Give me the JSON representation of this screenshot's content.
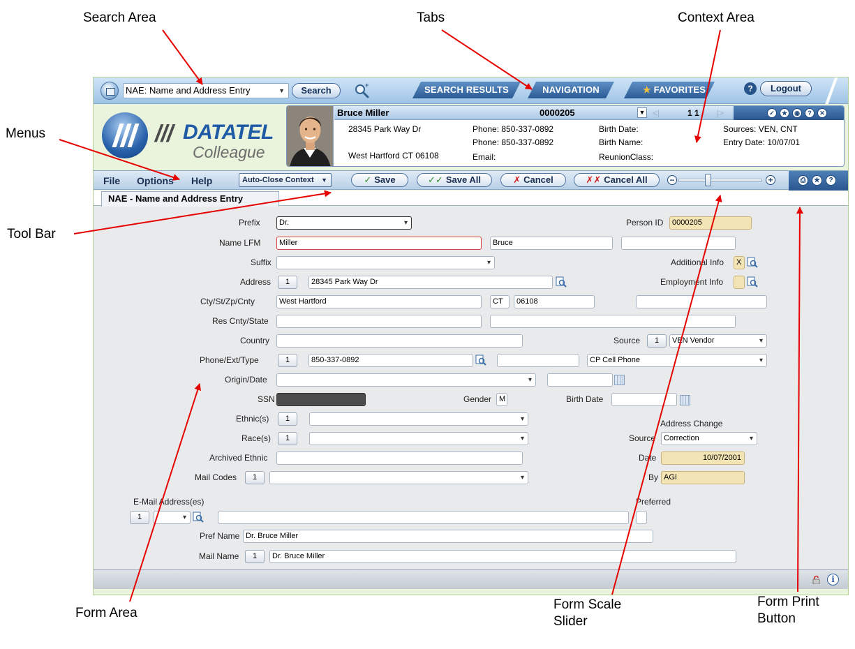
{
  "callouts": {
    "search_area": "Search Area",
    "tabs": "Tabs",
    "context_area": "Context Area",
    "menus": "Menus",
    "tool_bar": "Tool Bar",
    "form_area": "Form Area",
    "form_scale_slider_line1": "Form Scale",
    "form_scale_slider_line2": "Slider",
    "form_print_button_line1": "Form Print",
    "form_print_button_line2": "Button"
  },
  "topbar": {
    "search_select_value": "NAE: Name and Address Entry",
    "search_button": "Search",
    "tabs": [
      "SEARCH RESULTS",
      "NAVIGATION",
      "FAVORITES"
    ],
    "help": "?",
    "logout": "Logout"
  },
  "logo": {
    "brand": "DATATEL",
    "slashes": "///",
    "product": "Colleague"
  },
  "context": {
    "name": "Bruce Miller",
    "id": "0000205",
    "pager": "1  1",
    "address1": "28345 Park Way Dr",
    "address2": "West Hartford CT 06108",
    "phone1": "Phone: 850-337-0892",
    "phone2": "Phone: 850-337-0892",
    "email": "Email:",
    "birth_date": "Birth Date:",
    "birth_name": "Birth Name:",
    "reunion_class": "ReunionClass:",
    "sources": "Sources: VEN, CNT",
    "entry_date": "Entry Date: 10/07/01"
  },
  "toolbar": {
    "menus": [
      "File",
      "Options",
      "Help"
    ],
    "auto_close": "Auto-Close Context",
    "save": "Save",
    "save_all": "Save All",
    "cancel": "Cancel",
    "cancel_all": "Cancel All",
    "scale_minus": "−",
    "scale_plus": "+",
    "scale_level": 0.34
  },
  "form_tab": "NAE - Name and Address Entry",
  "form": {
    "prefix_label": "Prefix",
    "prefix_value": "Dr.",
    "person_id_label": "Person ID",
    "person_id_value": "0000205",
    "name_label": "Name LFM",
    "last_name": "Miller",
    "first_name": "Bruce",
    "middle_name": "",
    "suffix_label": "Suffix",
    "suffix_value": "",
    "additional_info_label": "Additional Info",
    "additional_info_value": "X",
    "address_label": "Address",
    "address_count": "1",
    "address_value": "28345 Park Way Dr",
    "employment_info_label": "Employment Info",
    "employment_info_value": "",
    "city_label": "Cty/St/Zp/Cnty",
    "city_value": "West Hartford",
    "state_value": "CT",
    "zip_value": "06108",
    "county_value": "",
    "res_label": "Res Cnty/State",
    "res_county_value": "",
    "res_state_value": "",
    "country_label": "Country",
    "country_value": "",
    "source_label": "Source",
    "source_count": "1",
    "source_value": "VEN Vendor",
    "phone_label": "Phone/Ext/Type",
    "phone_count": "1",
    "phone_value": "850-337-0892",
    "phone_ext_value": "",
    "phone_type_value": "CP Cell Phone",
    "origin_label": "Origin/Date",
    "origin_value": "",
    "origin_date_value": "",
    "ssn_label": "SSN",
    "gender_label": "Gender",
    "gender_value": "M",
    "birth_date_label": "Birth Date",
    "birth_date_value": "",
    "ethnic_label": "Ethnic(s)",
    "ethnic_count": "1",
    "ethnic_value": "",
    "address_change_label": "Address Change",
    "race_label": "Race(s)",
    "race_count": "1",
    "race_value": "",
    "ac_source_label": "Source",
    "ac_source_value": "Correction",
    "archived_ethnic_label": "Archived Ethnic",
    "archived_ethnic_value": "",
    "ac_date_label": "Date",
    "ac_date_value": "10/07/2001",
    "mail_codes_label": "Mail Codes",
    "mail_codes_count": "1",
    "mail_codes_value": "",
    "ac_by_label": "By",
    "ac_by_value": "AGI",
    "email_label": "E-Mail Address(es)",
    "preferred_label": "Preferred",
    "email_count": "1",
    "email_type_value": "",
    "email_value": "",
    "email_preferred_value": "",
    "pref_name_label": "Pref Name",
    "pref_name_value": "Dr. Bruce Miller",
    "mail_name_label": "Mail Name",
    "mail_name_count": "1",
    "mail_name_value": "Dr. Bruce Miller"
  },
  "colors": {
    "frame_bg": "#eaf4dc",
    "tab_blue": "#2b5b94",
    "form_bg": "#e9eaec",
    "readonly_fill": "#f3e4b5",
    "arrow_red": "#e60000"
  }
}
